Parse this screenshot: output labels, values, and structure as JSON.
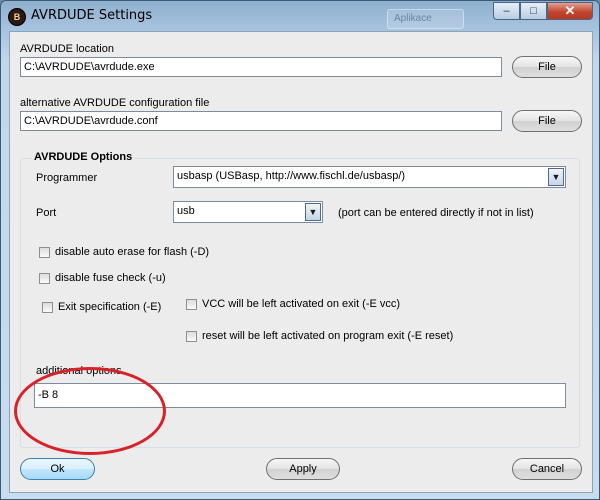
{
  "window": {
    "title": "AVRDUDE Settings",
    "app_icon_glyph": "B",
    "background_window_hint": "Aplikace",
    "minimize_glyph": "–",
    "maximize_glyph": "□",
    "close_glyph": "✕"
  },
  "location": {
    "label": "AVRDUDE location",
    "value": "C:\\AVRDUDE\\avrdude.exe",
    "file_button": "File"
  },
  "config": {
    "label": "alternative AVRDUDE configuration file",
    "value": "C:\\AVRDUDE\\avrdude.conf",
    "file_button": "File"
  },
  "options": {
    "group_title": "AVRDUDE Options",
    "programmer_label": "Programmer",
    "programmer_value": "usbasp (USBasp, http://www.fischl.de/usbasp/)",
    "port_label": "Port",
    "port_value": "usb",
    "port_hint": "(port can be entered directly if not in list)",
    "disable_auto_erase": "disable auto erase for flash (-D)",
    "disable_fuse_check": "disable fuse check (-u)",
    "exit_spec": "Exit specification (-E)",
    "vcc_active": "VCC will be left activated on exit (-E vcc)",
    "reset_active": "reset will be left activated on program exit (-E reset)",
    "additional_label": "additional options",
    "additional_value": "-B 8",
    "checked": {
      "disable_auto_erase": false,
      "disable_fuse_check": false,
      "exit_spec": false,
      "vcc_active": false,
      "reset_active": false
    }
  },
  "buttons": {
    "ok": "Ok",
    "apply": "Apply",
    "cancel": "Cancel"
  },
  "colors": {
    "highlight_ellipse": "#d8222a",
    "primary_button": "#bee6fd"
  },
  "icons": {
    "combo_arrow": "▼"
  }
}
